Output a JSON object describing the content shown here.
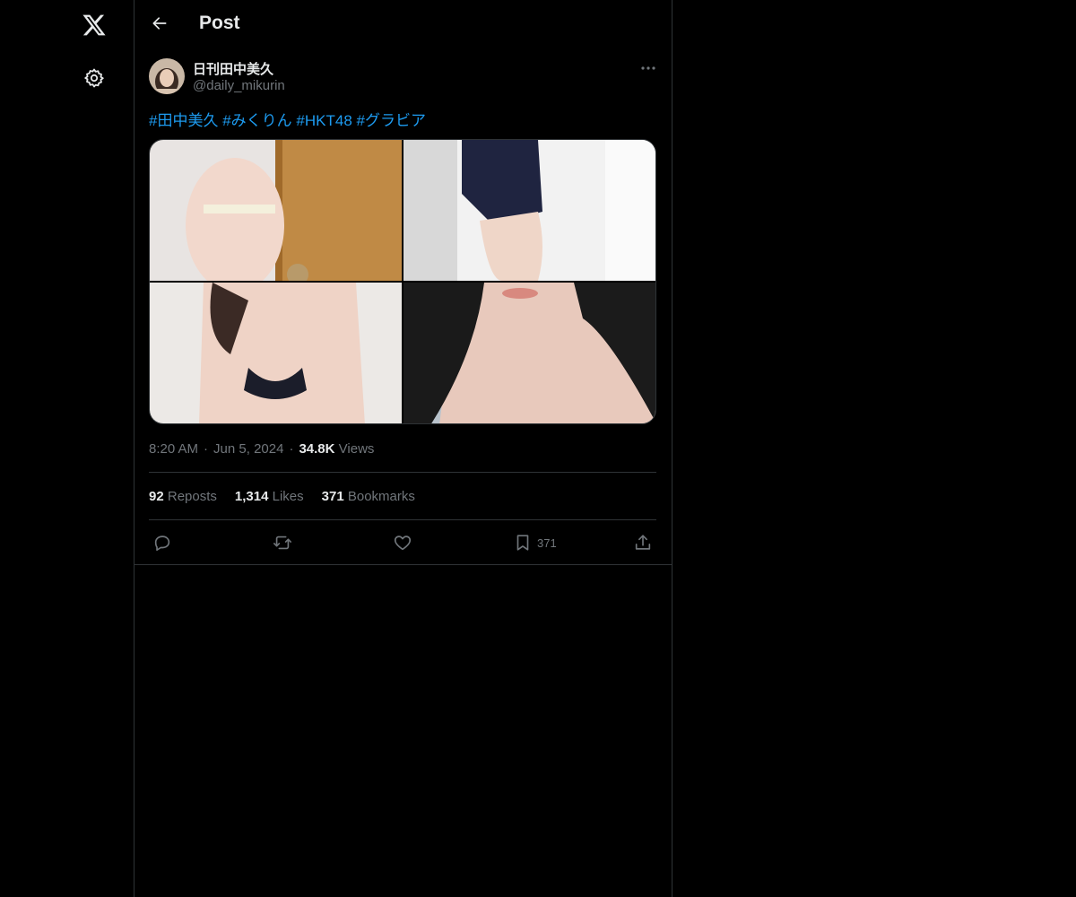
{
  "header": {
    "title": "Post"
  },
  "author": {
    "display_name": "日刊田中美久",
    "handle": "@daily_mikurin"
  },
  "tweet": {
    "hashtags": [
      "#田中美久",
      "#みくりん",
      "#HKT48",
      "#グラビア"
    ]
  },
  "meta": {
    "time": "8:20 AM",
    "date": "Jun 5, 2024",
    "views_count": "34.8K",
    "views_label": "Views",
    "separator": "·"
  },
  "stats": {
    "reposts_count": "92",
    "reposts_label": "Reposts",
    "likes_count": "1,314",
    "likes_label": "Likes",
    "bookmarks_count": "371",
    "bookmarks_label": "Bookmarks"
  },
  "actions": {
    "bookmark_count": "371"
  },
  "icons": {
    "logo": "x-logo-icon",
    "settings": "gear-icon",
    "back": "arrow-left-icon",
    "more": "more-dots-icon",
    "reply": "reply-icon",
    "repost": "repost-icon",
    "like": "heart-icon",
    "bookmark": "bookmark-icon",
    "share": "share-icon"
  },
  "colors": {
    "background": "#000000",
    "border": "#2f3336",
    "accent": "#1d9bf0",
    "muted": "#71767b",
    "text": "#e7e9ea"
  }
}
